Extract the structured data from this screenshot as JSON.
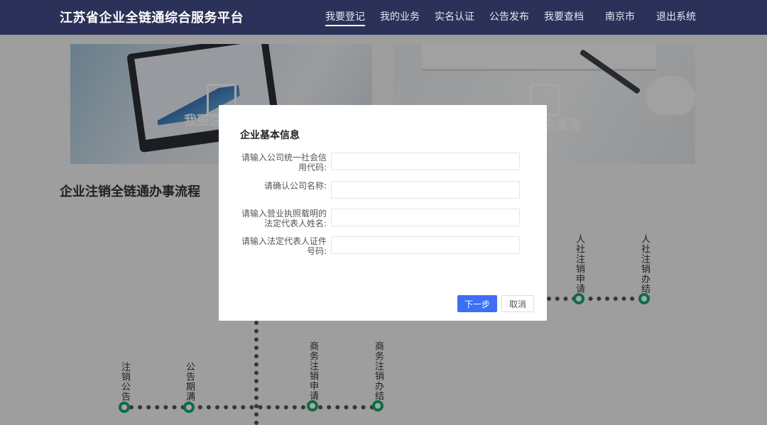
{
  "header": {
    "brand": "江苏省企业全链通综合服务平台",
    "nav": [
      {
        "label": "我要登记",
        "active": true
      },
      {
        "label": "我的业务",
        "active": false
      },
      {
        "label": "实名认证",
        "active": false
      },
      {
        "label": "公告发布",
        "active": false
      },
      {
        "label": "我要查档",
        "active": false
      },
      {
        "label": "南京市",
        "active": false
      },
      {
        "label": "退出系统",
        "active": false
      }
    ]
  },
  "cards": [
    {
      "title": "我要注",
      "icon": "document-icon"
    },
    {
      "title": "告查询",
      "icon": "search-doc-icon"
    }
  ],
  "flow": {
    "title": "企业注销全链通办事流程",
    "steps": [
      "注销公告",
      "公告期满",
      "商务注销申请",
      "商务注销办结",
      "人社注销申请",
      "人社注销办结"
    ]
  },
  "modal": {
    "title": "企业基本信息",
    "fields": [
      {
        "label": "请输入公司统一社会信用代码:",
        "value": "",
        "placeholder": ""
      },
      {
        "label": "请确认公司名称:",
        "value": "",
        "placeholder": ""
      },
      {
        "label": "请输入营业执照载明的法定代表人姓名:",
        "value": "",
        "placeholder": ""
      },
      {
        "label": "请输入法定代表人证件号码:",
        "value": "",
        "placeholder": ""
      }
    ],
    "next_label": "下一步",
    "cancel_label": "取消"
  },
  "colors": {
    "header_bg": "#2b3158",
    "accent": "#3c6ef6",
    "node": "#14a86b"
  }
}
